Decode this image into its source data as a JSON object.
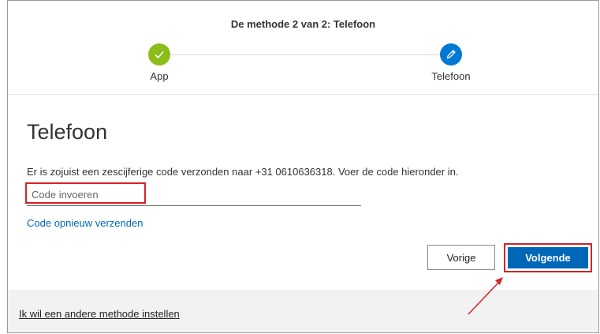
{
  "progress": {
    "title": "De methode 2 van 2: Telefoon",
    "steps": [
      {
        "label": "App",
        "status": "completed",
        "icon": "checkmark-icon"
      },
      {
        "label": "Telefoon",
        "status": "current",
        "icon": "pencil-icon"
      }
    ]
  },
  "main": {
    "title": "Telefoon",
    "info_text": "Er is zojuist een zescijferige code verzonden naar +31 0610636318. Voer de code hieronder in.",
    "code_input": {
      "value": "",
      "placeholder": "Code invoeren"
    },
    "resend_link": "Code opnieuw verzenden",
    "prev_button": "Vorige",
    "next_button": "Volgende"
  },
  "footer": {
    "link": "Ik wil een andere methode instellen"
  },
  "colors": {
    "completed": "#8cbd18",
    "current": "#0078d4",
    "primary_button": "#0067b8",
    "link": "#0067b8",
    "highlight": "#d42226",
    "footer_bg": "#f2f2f2"
  }
}
